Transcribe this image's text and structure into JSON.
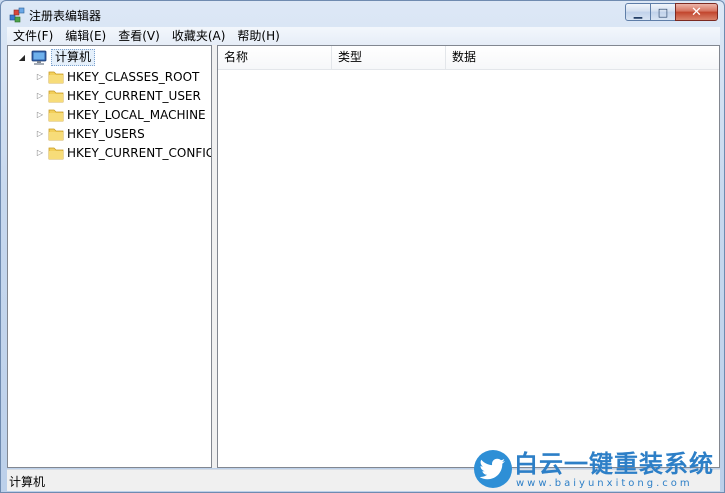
{
  "window": {
    "title": "注册表编辑器",
    "controls": {
      "minimize": "▁",
      "maximize": "□",
      "close": "✕"
    }
  },
  "menu": [
    "文件(F)",
    "编辑(E)",
    "查看(V)",
    "收藏夹(A)",
    "帮助(H)"
  ],
  "tree": {
    "root": {
      "label": "计算机",
      "icon": "computer-icon",
      "expanded": true
    },
    "hives": [
      {
        "label": "HKEY_CLASSES_ROOT",
        "icon": "folder-icon"
      },
      {
        "label": "HKEY_CURRENT_USER",
        "icon": "folder-icon"
      },
      {
        "label": "HKEY_LOCAL_MACHINE",
        "icon": "folder-icon"
      },
      {
        "label": "HKEY_USERS",
        "icon": "folder-icon"
      },
      {
        "label": "HKEY_CURRENT_CONFIG",
        "icon": "folder-icon"
      }
    ]
  },
  "list": {
    "columns": [
      "名称",
      "类型",
      "数据"
    ],
    "rows": []
  },
  "statusbar": {
    "path": "计算机"
  },
  "watermark": {
    "title": "白云一键重装系统",
    "url": "www.baiyunxitong.com"
  },
  "colors": {
    "folder": "#f2cf5b",
    "accent": "#2d7fc7",
    "close": "#c2442c"
  }
}
